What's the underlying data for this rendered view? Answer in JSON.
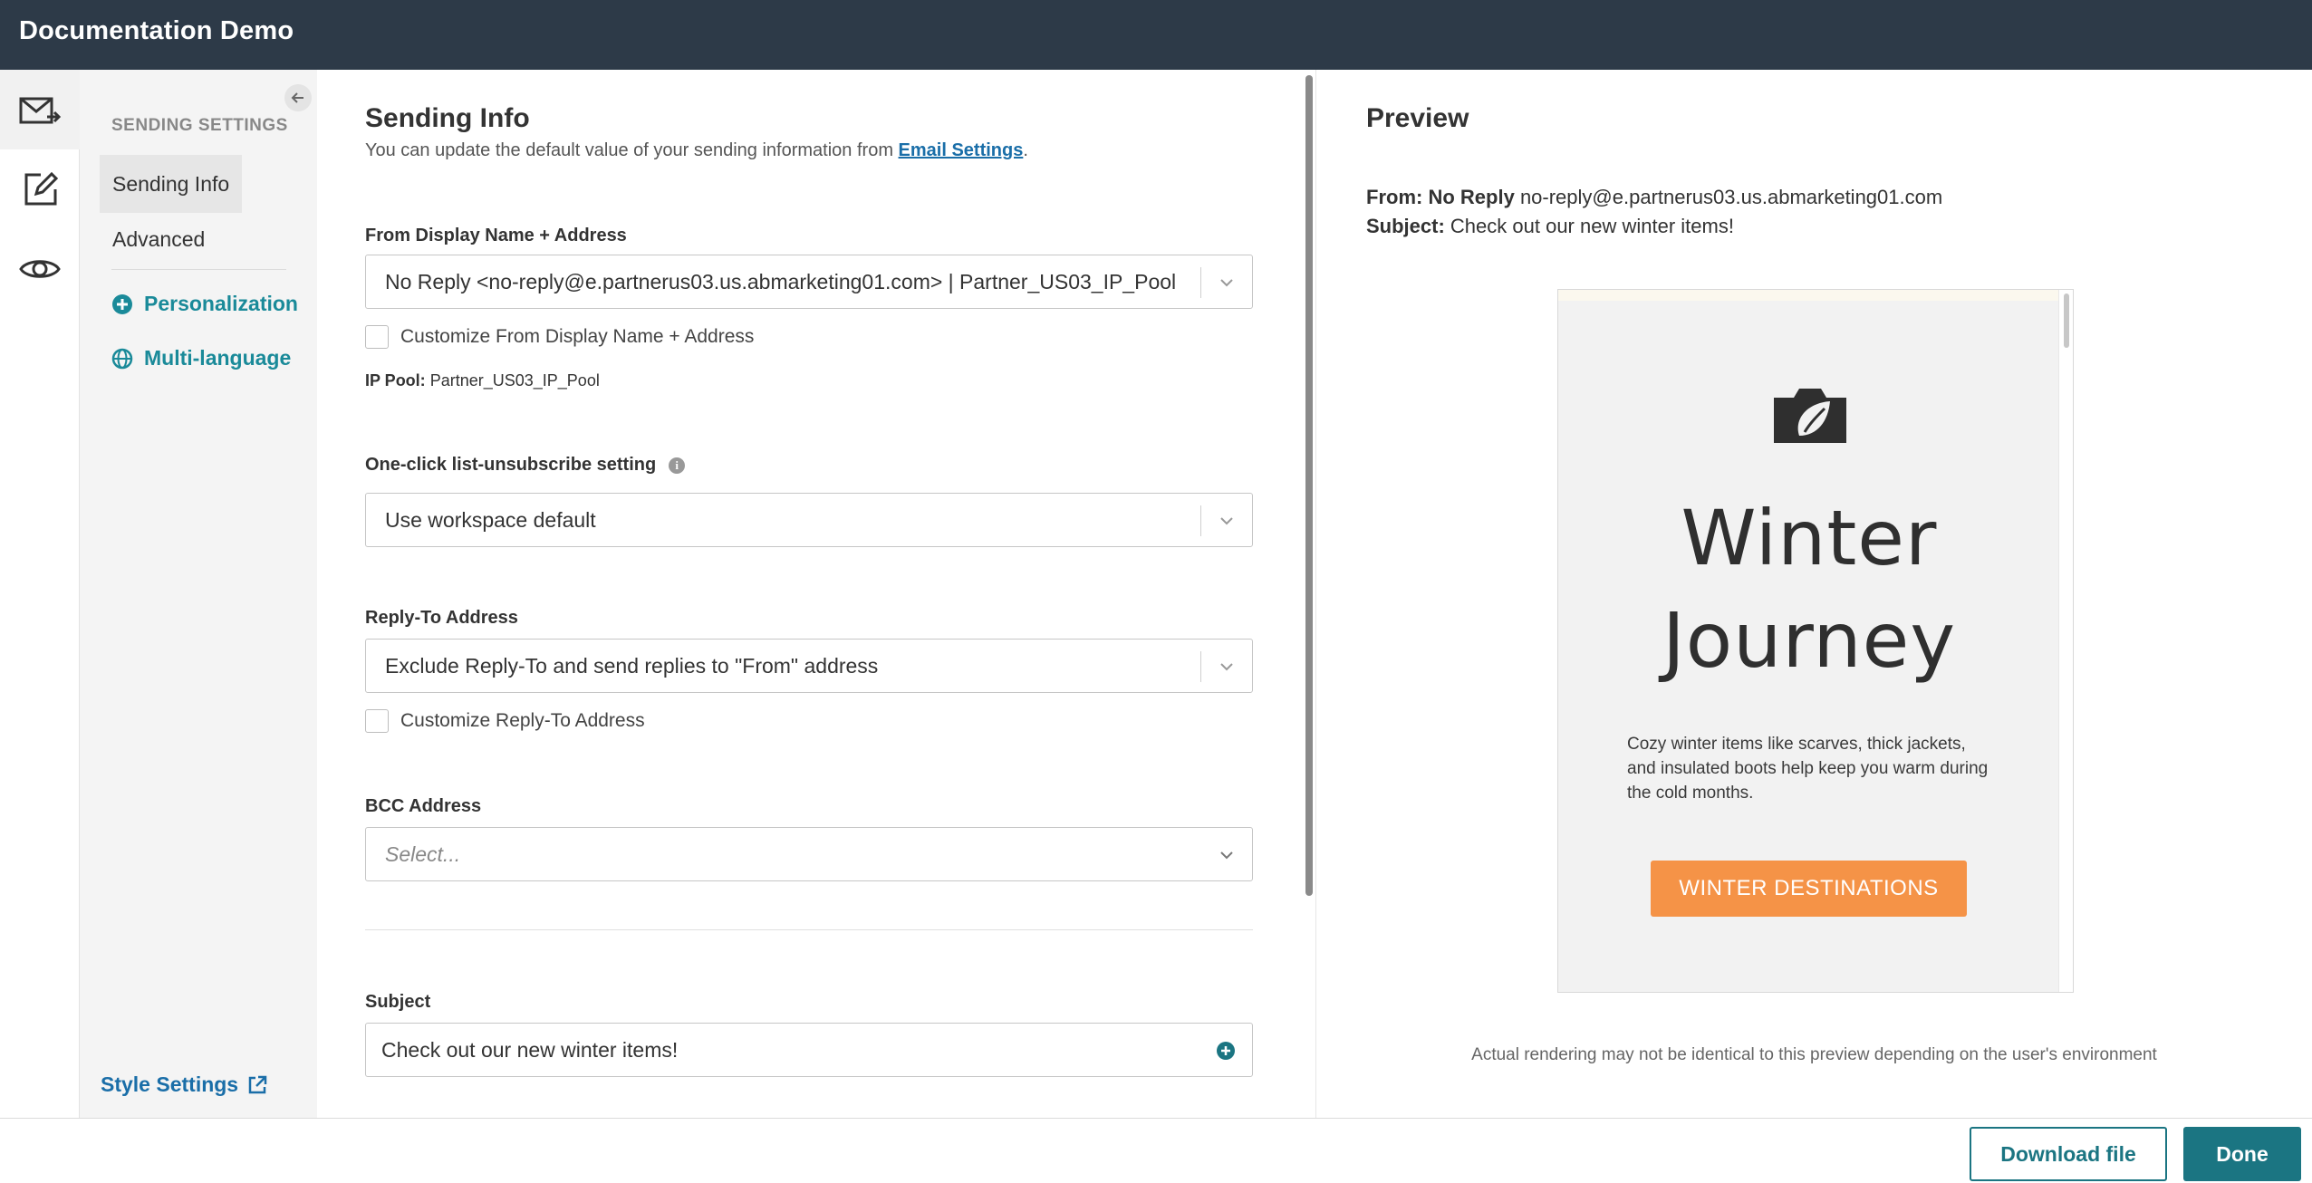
{
  "app": {
    "title": "Documentation Demo"
  },
  "rail": {
    "items": [
      {
        "icon": "mail-send-icon",
        "active": true
      },
      {
        "icon": "edit-icon",
        "active": false
      },
      {
        "icon": "eye-icon",
        "active": false
      }
    ]
  },
  "subnav": {
    "heading": "SENDING SETTINGS",
    "items": [
      {
        "label": "Sending Info",
        "selected": true
      },
      {
        "label": "Advanced",
        "selected": false
      }
    ],
    "links": [
      {
        "label": "Personalization",
        "icon": "plus-circle-icon"
      },
      {
        "label": "Multi-language",
        "icon": "globe-icon"
      }
    ],
    "style_settings": "Style Settings"
  },
  "form": {
    "title": "Sending Info",
    "intro_prefix": "You can update the default value of your sending information from ",
    "intro_link": "Email Settings",
    "intro_suffix": ".",
    "from": {
      "label": "From Display Name + Address",
      "value": "No Reply <no-reply@e.partnerus03.us.abmarketing01.com> | Partner_US03_IP_Pool",
      "customize": "Customize From Display Name + Address",
      "ip_pool_label": "IP Pool:",
      "ip_pool_value": "Partner_US03_IP_Pool"
    },
    "unsubscribe": {
      "label": "One-click list-unsubscribe setting",
      "value": "Use workspace default"
    },
    "reply_to": {
      "label": "Reply-To Address",
      "value": "Exclude Reply-To and send replies to \"From\" address",
      "customize": "Customize Reply-To Address"
    },
    "bcc": {
      "label": "BCC Address",
      "placeholder": "Select..."
    },
    "subject": {
      "label": "Subject",
      "value": "Check out our new winter items!"
    }
  },
  "preview": {
    "title": "Preview",
    "from_label": "From:",
    "from_name": "No Reply",
    "from_address": "no-reply@e.partnerus03.us.abmarketing01.com",
    "subject_label": "Subject:",
    "subject_value": "Check out our new winter items!",
    "email": {
      "headline_1": "Winter",
      "headline_2": "Journey",
      "body": "Cozy winter items like scarves, thick jackets, and insulated boots help keep you warm during the cold months.",
      "cta": "WINTER DESTINATIONS"
    },
    "disclaimer": "Actual rendering may not be identical to this preview depending on the user's environment"
  },
  "footer": {
    "download": "Download file",
    "done": "Done"
  },
  "colors": {
    "topbar": "#2d3a48",
    "accent": "#1b7582",
    "link": "#1a6ea8",
    "cta": "#f59347"
  }
}
